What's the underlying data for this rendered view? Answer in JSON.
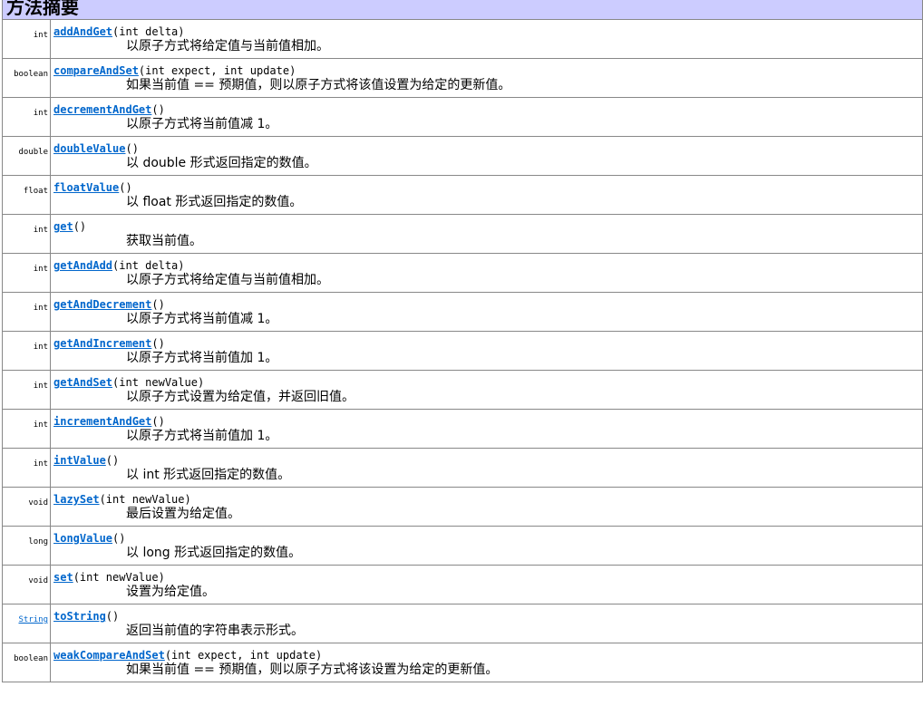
{
  "header": {
    "title": "方法摘要"
  },
  "methods": [
    {
      "type": "int",
      "name": "addAndGet",
      "params": "(int delta)",
      "desc": "以原子方式将给定值与当前值相加。"
    },
    {
      "type": "boolean",
      "name": "compareAndSet",
      "params": "(int expect, int update)",
      "desc": "如果当前值 == 预期值，则以原子方式将该值设置为给定的更新值。"
    },
    {
      "type": "int",
      "name": "decrementAndGet",
      "params": "()",
      "desc": "以原子方式将当前值减 1。"
    },
    {
      "type": "double",
      "name": "doubleValue",
      "params": "()",
      "desc": "以 double 形式返回指定的数值。"
    },
    {
      "type": "float",
      "name": "floatValue",
      "params": "()",
      "desc": "以 float 形式返回指定的数值。"
    },
    {
      "type": "int",
      "name": "get",
      "params": "()",
      "desc": "获取当前值。"
    },
    {
      "type": "int",
      "name": "getAndAdd",
      "params": "(int delta)",
      "desc": "以原子方式将给定值与当前值相加。"
    },
    {
      "type": "int",
      "name": "getAndDecrement",
      "params": "()",
      "desc": "以原子方式将当前值减 1。"
    },
    {
      "type": "int",
      "name": "getAndIncrement",
      "params": "()",
      "desc": "以原子方式将当前值加 1。"
    },
    {
      "type": "int",
      "name": "getAndSet",
      "params": "(int newValue)",
      "desc": "以原子方式设置为给定值，并返回旧值。"
    },
    {
      "type": "int",
      "name": "incrementAndGet",
      "params": "()",
      "desc": "以原子方式将当前值加 1。"
    },
    {
      "type": "int",
      "name": "intValue",
      "params": "()",
      "desc": "以 int 形式返回指定的数值。"
    },
    {
      "type": "void",
      "name": "lazySet",
      "params": "(int newValue)",
      "desc": "最后设置为给定值。"
    },
    {
      "type": "long",
      "name": "longValue",
      "params": "()",
      "desc": "以 long 形式返回指定的数值。"
    },
    {
      "type": "void",
      "name": "set",
      "params": "(int newValue)",
      "desc": "设置为给定值。"
    },
    {
      "type": "String",
      "name": "toString",
      "params": "()",
      "desc": "返回当前值的字符串表示形式。",
      "type_is_link": true
    },
    {
      "type": "boolean",
      "name": "weakCompareAndSet",
      "params": "(int expect, int update)",
      "desc": "如果当前值 == 预期值，则以原子方式将该设置为给定的更新值。"
    }
  ],
  "colors": {
    "header_bg": "#ccccff",
    "link": "#0066cc",
    "border": "#888888"
  }
}
